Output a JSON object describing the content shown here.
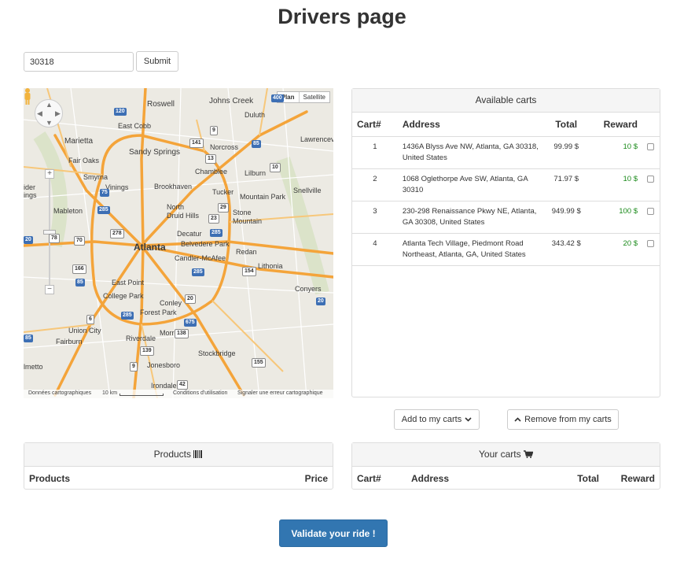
{
  "page": {
    "title": "Drivers page"
  },
  "search": {
    "zip_value": "30318",
    "submit_label": "Submit"
  },
  "map": {
    "type_plan": "Plan",
    "type_satellite": "Satellite",
    "zoom_in": "+",
    "zoom_out": "−",
    "labels": {
      "roswell": "Roswell",
      "johns_creek": "Johns Creek",
      "duluth": "Duluth",
      "lawrencev": "Lawrencev",
      "marietta": "Marietta",
      "east_cobb": "East Cobb",
      "sandy_springs": "Sandy Springs",
      "norcross": "Norcross",
      "fair_oaks": "Fair Oaks",
      "smyrna": "Smyrna",
      "chamblee": "Chamblee",
      "lilburn": "Lilburn",
      "vinings": "Vinings",
      "brookhaven": "Brookhaven",
      "tucker": "Tucker",
      "mountain_park": "Mountain Park",
      "snellville": "Snellville",
      "mableton": "Mableton",
      "north_druid_hills": "North\nDruid Hills",
      "stone_mountain": "Stone\nMountain",
      "decatur": "Decatur",
      "belvedere_park": "Belvedere Park",
      "atlanta": "Atlanta",
      "candler_mcafee": "Candler-McAfee",
      "redan": "Redan",
      "lithonia": "Lithonia",
      "east_point": "East Point",
      "college_park": "College Park",
      "conley": "Conley",
      "conyers": "Conyers",
      "forest_park": "Forest Park",
      "union_city": "Union City",
      "morrow": "Morrow",
      "fairburn": "Fairburn",
      "riverdale": "Riverdale",
      "stockbridge": "Stockbridge",
      "jonesboro": "Jonesboro",
      "irondale": "Irondale",
      "lmetto": "lmetto",
      "ider": "ider",
      "ings": "ings"
    },
    "shields": {
      "s400": "400",
      "s9": "9",
      "s285a": "285",
      "s120": "120",
      "s85a": "85",
      "s141": "141",
      "s13": "13",
      "s75": "75",
      "s285b": "285",
      "s29": "29",
      "s23": "23",
      "s78": "78",
      "s10": "10",
      "s278": "278",
      "s285c": "285",
      "s70": "70",
      "s20a": "20",
      "s166": "166",
      "s154": "154",
      "s85b": "85",
      "s285d": "285",
      "s6": "6",
      "s138": "138",
      "s675": "675",
      "s139": "139",
      "s20b": "20",
      "s85c": "85",
      "s155": "155",
      "s42": "42",
      "s20c": "20"
    },
    "footer": {
      "data": "Données cartographiques",
      "scale": "10 km",
      "terms": "Conditions d'utilisation",
      "report": "Signaler une erreur cartographique"
    }
  },
  "available_carts": {
    "heading": "Available carts",
    "headers": {
      "cart": "Cart#",
      "address": "Address",
      "total": "Total",
      "reward": "Reward"
    },
    "rows": [
      {
        "cart": "1",
        "address": "1436A Blyss Ave NW, Atlanta, GA 30318, United States",
        "total": "99.99 $",
        "reward": "10 $"
      },
      {
        "cart": "2",
        "address": "1068 Oglethorpe Ave SW, Atlanta, GA 30310",
        "total": "71.97 $",
        "reward": "10 $"
      },
      {
        "cart": "3",
        "address": "230-298 Renaissance Pkwy NE, Atlanta, GA 30308, United States",
        "total": "949.99 $",
        "reward": "100 $"
      },
      {
        "cart": "4",
        "address": "Atlanta Tech Village, Piedmont Road Northeast, Atlanta, GA, United States",
        "total": "343.42 $",
        "reward": "20 $"
      }
    ]
  },
  "actions": {
    "add_label": "Add to my carts",
    "remove_label": "Remove from my carts"
  },
  "products": {
    "heading": "Products",
    "col_products": "Products",
    "col_price": "Price"
  },
  "your_carts": {
    "heading": "Your carts",
    "col_cart": "Cart#",
    "col_address": "Address",
    "col_total": "Total",
    "col_reward": "Reward"
  },
  "validate": {
    "label": "Validate your ride !"
  },
  "colors": {
    "primary": "#3276b1",
    "reward": "#1a8a1a",
    "road": "#f4a43a",
    "map_bg": "#eceae3"
  }
}
